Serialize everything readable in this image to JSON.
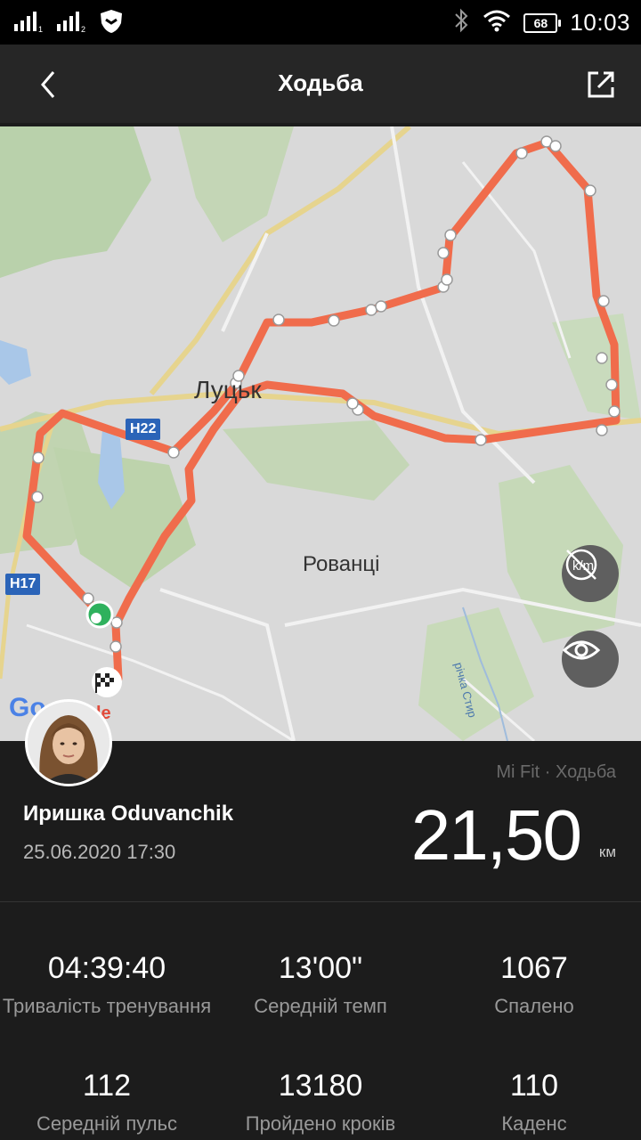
{
  "status_bar": {
    "time": "10:03",
    "battery": "68"
  },
  "header": {
    "title": "Ходьба"
  },
  "map": {
    "city_label": "Луцьк",
    "area_label": "Рованці",
    "river_label": "річка Стир",
    "route_badges": [
      "H22",
      "H17"
    ],
    "brand_fragment": "Go",
    "brand_fragment2": "le"
  },
  "colors": {
    "route": "#f06c4c",
    "accent_start": "#2fb15d"
  },
  "profile": {
    "name": "Иришка Oduvanchik",
    "datetime": "25.06.2020 17:30"
  },
  "summary": {
    "source": "Mi Fit · Ходьба",
    "distance": "21,50",
    "unit": "км"
  },
  "stats": [
    {
      "value": "04:39:40",
      "label": "Тривалість тренування"
    },
    {
      "value": "13'00\"",
      "label": "Середній темп"
    },
    {
      "value": "1067",
      "label": "Спалено"
    },
    {
      "value": "112",
      "label": "Середній пульс"
    },
    {
      "value": "13180",
      "label": "Пройдено кроків"
    },
    {
      "value": "110",
      "label": "Каденс"
    }
  ]
}
